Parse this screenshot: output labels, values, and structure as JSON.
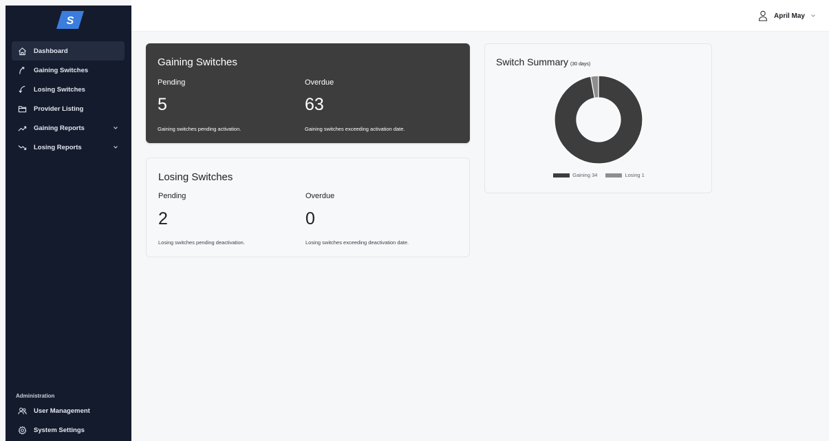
{
  "brand": {
    "logo_letter": "S"
  },
  "sidebar": {
    "items": [
      {
        "label": "Dashboard",
        "icon": "home-icon",
        "active": true
      },
      {
        "label": "Gaining Switches",
        "icon": "arrow-up-curved-icon"
      },
      {
        "label": "Losing Switches",
        "icon": "arrow-down-curved-icon"
      },
      {
        "label": "Provider Listing",
        "icon": "folder-icon"
      },
      {
        "label": "Gaining Reports",
        "icon": "trend-up-icon",
        "expandable": true
      },
      {
        "label": "Losing Reports",
        "icon": "trend-down-icon",
        "expandable": true
      }
    ],
    "admin_label": "Administration",
    "admin_items": [
      {
        "label": "User Management",
        "icon": "users-icon"
      },
      {
        "label": "System Settings",
        "icon": "settings-gear-icon"
      }
    ]
  },
  "header": {
    "user_name": "April May"
  },
  "gaining": {
    "title": "Gaining Switches",
    "pending_label": "Pending",
    "pending_value": "5",
    "pending_desc": "Gaining switches pending activation.",
    "overdue_label": "Overdue",
    "overdue_value": "63",
    "overdue_desc": "Gaining switches exceeding activation date."
  },
  "losing": {
    "title": "Losing Switches",
    "pending_label": "Pending",
    "pending_value": "2",
    "pending_desc": "Losing switches pending deactivation.",
    "overdue_label": "Overdue",
    "overdue_value": "0",
    "overdue_desc": "Losing switches exceeding deactivation date."
  },
  "summary": {
    "title": "Switch Summary",
    "subtitle": "(30 days)"
  },
  "chart_data": {
    "type": "pie",
    "donut": true,
    "title": "Switch Summary",
    "categories": [
      "Gaining",
      "Losing"
    ],
    "values": [
      34,
      1
    ],
    "legend_labels": [
      "Gaining 34",
      "Losing 1"
    ],
    "colors": [
      "#3d3d3d",
      "#8e8e8e"
    ],
    "legend": "bottom"
  }
}
